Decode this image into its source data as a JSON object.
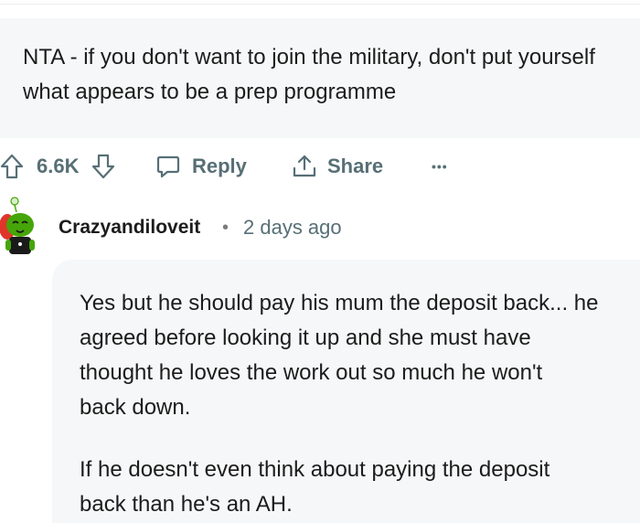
{
  "parent_comment": {
    "text": "NTA - if you don't want to join the military, don't put yourself what appears to be a prep programme"
  },
  "actions": {
    "score": "6.6K",
    "reply_label": "Reply",
    "share_label": "Share",
    "more_label": "•••",
    "upvote_icon": "arrow-up-icon",
    "downvote_icon": "arrow-down-icon",
    "reply_icon": "speech-bubble-icon",
    "share_icon": "share-arrow-icon"
  },
  "reply_comment": {
    "author": "Crazyandiloveit",
    "separator": "•",
    "timestamp": "2 days ago",
    "paragraphs": [
      "Yes but he should pay his mum the deposit back... he\nagreed before looking it up and she must have\nthought he loves the work out so much he won't\nback down.",
      "If he doesn't even think about paying the deposit\nback than he's an AH."
    ]
  },
  "colors": {
    "comment_bg": "#f6f7f8",
    "meta_grey": "#576f76",
    "avatar_green": "#46a508",
    "avatar_red": "#e0352b"
  }
}
